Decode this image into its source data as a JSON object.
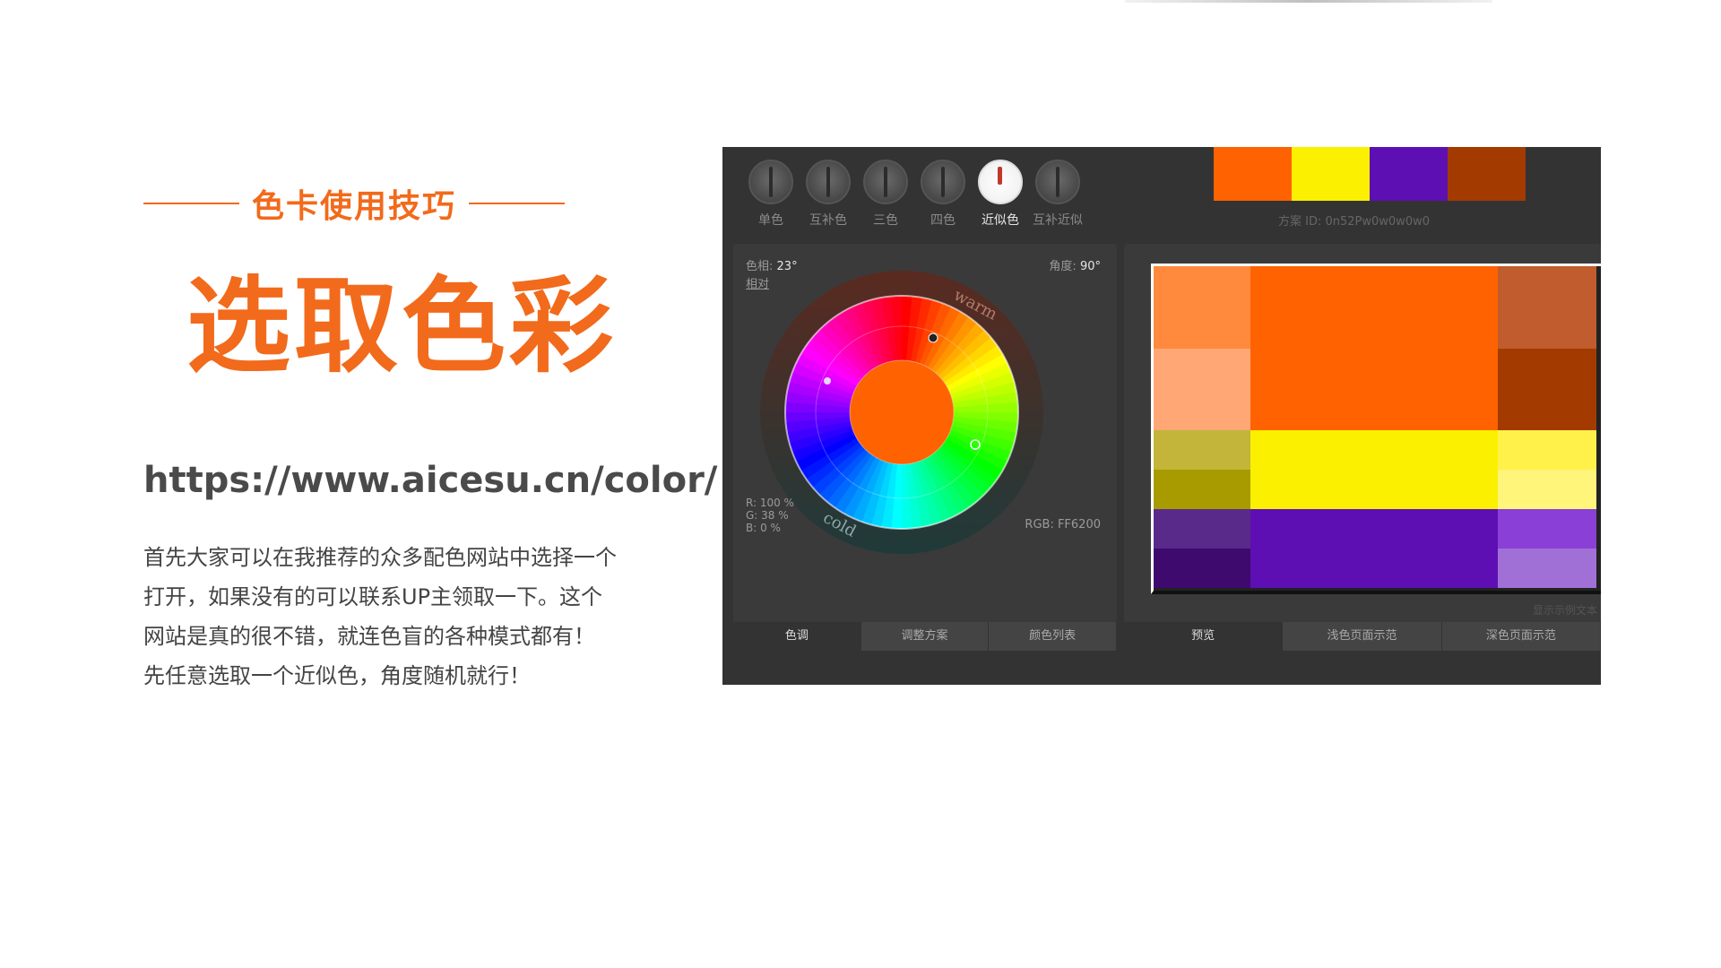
{
  "slide": {
    "subtitle": "色卡使用技巧",
    "title": "选取色彩",
    "url": "https://www.aicesu.cn/color/",
    "description": [
      "首先大家可以在我推荐的众多配色网站中选择一个",
      "打开，如果没有的可以联系UP主领取一下。这个",
      "网站是真的很不错，就连色盲的各种模式都有！",
      "先任意选取一个近似色，角度随机就行！"
    ]
  },
  "colors": {
    "accent": "#f26a1b",
    "panel_bg": "#333333"
  },
  "app": {
    "modes": [
      {
        "label": "单色",
        "icon": "knob-icon"
      },
      {
        "label": "互补色",
        "icon": "knob-icon"
      },
      {
        "label": "三色",
        "icon": "knob-icon"
      },
      {
        "label": "四色",
        "icon": "knob-icon"
      },
      {
        "label": "近似色",
        "icon": "knob-icon",
        "active": true
      },
      {
        "label": "互补近似",
        "icon": "knob-icon"
      }
    ],
    "palette": [
      "#FF6200",
      "#FBF000",
      "#5E0FB3",
      "#A33A00"
    ],
    "scheme_id": "方案 ID: 0n52Pw0w0w0w0",
    "wheel": {
      "hue_label": "色相:",
      "hue_value": "23°",
      "relative_link": "相对",
      "angle_label": "角度:",
      "angle_value": "90°",
      "warm_label": "warm",
      "cold_label": "cold",
      "rgb_r": "R: 100 %",
      "rgb_g": "G:  38 %",
      "rgb_b": "B:    0 %",
      "rgb_hex": "RGB: FF6200",
      "center_color": "#FF6200"
    },
    "wheel_tabs": [
      "色调",
      "调整方案",
      "颜色列表"
    ],
    "preview": {
      "hint": "显示示例文本",
      "tabs": [
        "预览",
        "浅色页面示范",
        "深色页面示范"
      ],
      "rows": [
        {
          "left": "#FF8A3D",
          "main": "#FF6200",
          "right": "#C05C2E"
        },
        {
          "left": "#FFA775",
          "main": "#FF6200",
          "right": "#A33A00"
        },
        {
          "left": "#C2B53A",
          "main": "#FBF000",
          "right": "#FFF14A"
        },
        {
          "left": "#A89B00",
          "main": "#FBF000",
          "right": "#FFF57A"
        },
        {
          "left": "#5A2A8A",
          "main": "#5E0FB3",
          "right": "#8A3FD6"
        },
        {
          "left": "#3E0A6E",
          "main": "#5E0FB3",
          "right": "#A070D6"
        }
      ]
    }
  }
}
